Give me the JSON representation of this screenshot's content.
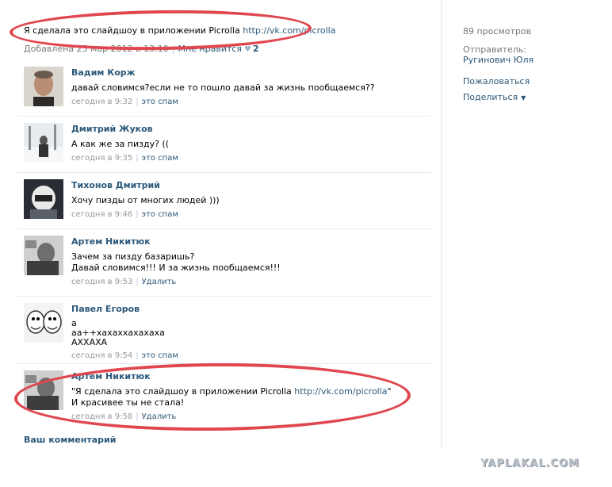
{
  "post": {
    "text": "Я сделала это слайдшоу в приложении Picrolla ",
    "link": "http://vk.com/picrolla",
    "added": "Добавлена 25 мар 2012 в 13:10",
    "like_label": "Мне нравится",
    "like_count": "2"
  },
  "sidebar": {
    "views": "89 просмотров",
    "sender_label": "Отправитель:",
    "sender_name": "Ругинович Юля",
    "report": "Пожаловаться",
    "share": "Поделиться"
  },
  "comments": [
    {
      "author": "Вадим Корж",
      "lines": [
        "давай словимся?если не то пошло давай за жизнь пообщаемся??"
      ],
      "time": "сегодня в 9:32",
      "action": "это спам"
    },
    {
      "author": "Дмитрий Жуков",
      "lines": [
        "А как же за пизду? (("
      ],
      "time": "сегодня в 9:35",
      "action": "это спам"
    },
    {
      "author": "Тихонов Дмитрий",
      "lines": [
        "Хочу пизды от многих людей )))"
      ],
      "time": "сегодня в 9:46",
      "action": "это спам"
    },
    {
      "author": "Артем Никитюк",
      "lines": [
        "Зачем за пизду базаришь?",
        "Давай словимся!!! И за жизнь пообщаемся!!!"
      ],
      "time": "сегодня в 9:53",
      "action": "Удалить"
    },
    {
      "author": "Павел Егоров",
      "lines": [
        "а",
        "аа++хахаххахахаха",
        "АХХАХА"
      ],
      "time": "сегодня в 9:54",
      "action": "это спам"
    },
    {
      "author": "Артём Никитюк",
      "lines": [
        "\"Я сделала это слайдшоу в приложении Picrolla ",
        "И красивее ты не стала!"
      ],
      "link": "http://vk.com/picrolla",
      "link_suffix": "\"",
      "time": "сегодня в 9:58",
      "action": "Удалить"
    }
  ],
  "your_comment": "Ваш комментарий",
  "watermark": "YAPLAKAL.COM",
  "colors": {
    "link": "#2b587a",
    "annotation": "#e0474f",
    "meta": "#999999"
  }
}
